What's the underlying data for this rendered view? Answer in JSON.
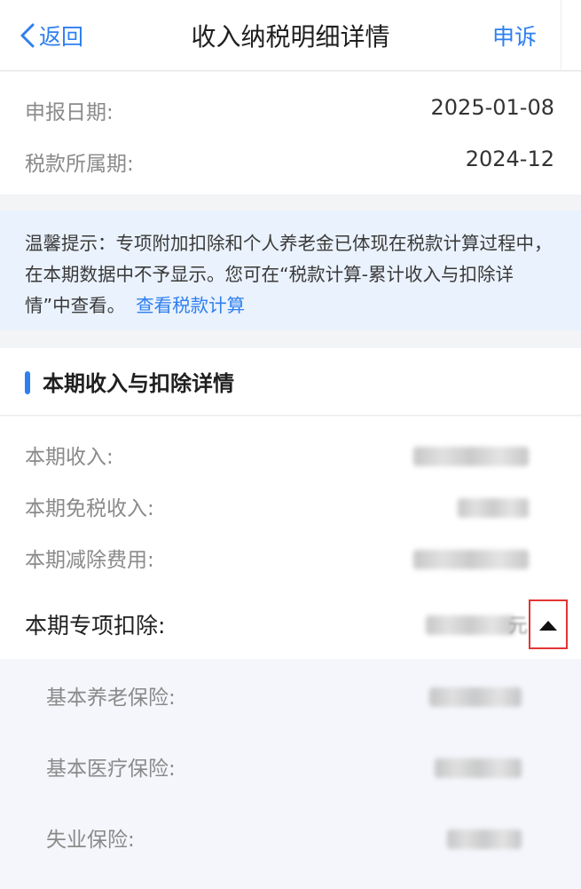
{
  "nav": {
    "back_label": "返回",
    "title": "收入纳税明细详情",
    "appeal_label": "申诉"
  },
  "info": {
    "declare_date_label": "申报日期:",
    "declare_date_value": "2025-01-08",
    "tax_period_label": "税款所属期:",
    "tax_period_value": "2024-12"
  },
  "tip": {
    "text": "温馨提示：专项附加扣除和个人养老金已体现在税款计算过程中，在本期数据中不予显示。您可在“税款计算-累计收入与扣除详情”中查看。",
    "link_label": "查看税款计算"
  },
  "section": {
    "title": "本期收入与扣除详情"
  },
  "income": {
    "current_income_label": "本期收入:",
    "tax_free_income_label": "本期免税收入:",
    "deduction_expense_label": "本期减除费用:",
    "special_deduction_label": "本期专项扣除:",
    "special_deduction_unit": "元"
  },
  "special_items": {
    "pension_label": "基本养老保险:",
    "medical_label": "基本医疗保险:",
    "unemployment_label": "失业保险:"
  },
  "colors": {
    "accent": "#2e7ff0",
    "highlight_border": "#e23535"
  }
}
